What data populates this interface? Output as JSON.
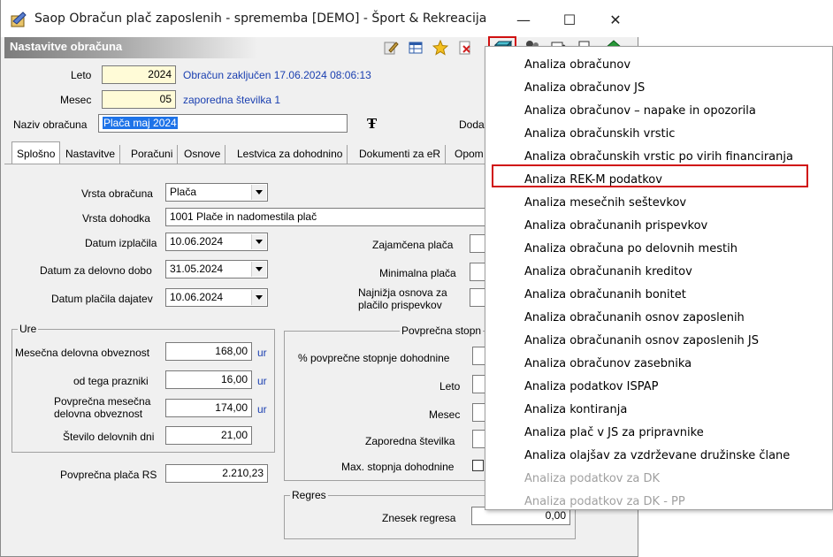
{
  "window": {
    "title": "Saop Obračun plač zaposlenih - sprememba [DEMO] - Šport & Rekreacija",
    "minimize": "—",
    "maximize": "☐",
    "close": "✕"
  },
  "panel": {
    "title": "Nastavitve obračuna"
  },
  "header": {
    "leto_label": "Leto",
    "leto_value": "2024",
    "obracun_status": "Obračun zaključen 17.06.2024 08:06:13",
    "mesec_label": "Mesec",
    "mesec_value": "05",
    "zaporedna": "zaporedna številka 1",
    "naziv_label": "Naziv obračuna",
    "naziv_value": "Plača maj 2024",
    "doda_label": "Doda"
  },
  "tabs": [
    "Splošno",
    "Nastavitve",
    "Poračuni",
    "Osnove",
    "Lestvica za dohodnino",
    "Dokumenti za eR",
    "Opom"
  ],
  "general": {
    "vrsta_obracuna_label": "Vrsta obračuna",
    "vrsta_obracuna_value": "Plača",
    "vrsta_dohodka_label": "Vrsta dohodka",
    "vrsta_dohodka_value": "1001  Plače in nadomestila plač",
    "datum_izplacila_label": "Datum izplačila",
    "datum_izplacila_value": "10.06.2024",
    "datum_delovno_label": "Datum za delovno dobo",
    "datum_delovno_value": "31.05.2024",
    "datum_dajatev_label": "Datum plačila dajatev",
    "datum_dajatev_value": "10.06.2024",
    "zajamcena_label": "Zajamčena plača",
    "minimalna_label": "Minimalna plača",
    "najnizja_label_1": "Najnižja osnova za",
    "najnizja_label_2": "plačilo prispevkov"
  },
  "ure": {
    "title": "Ure",
    "mesecna_label": "Mesečna delovna obveznost",
    "mesecna_value": "168,00",
    "prazniki_label": "od tega prazniki",
    "prazniki_value": "16,00",
    "povprecna_label_1": "Povprečna mesečna",
    "povprecna_label_2": "delovna obveznost",
    "povprecna_value": "174,00",
    "dni_label": "Število delovnih dni",
    "dni_value": "21,00",
    "unit": "ur"
  },
  "placa_rs": {
    "label": "Povprečna plača RS",
    "value": "2.210,23"
  },
  "stopnja": {
    "title": "Povprečna stopn",
    "pct_label": "% povprečne stopnje dohodnine",
    "leto_label": "Leto",
    "mesec_label": "Mesec",
    "zaporedna_label": "Zaporedna številka",
    "max_label": "Max. stopnja dohodnine"
  },
  "regres": {
    "title": "Regres",
    "znesek_label": "Znesek regresa",
    "znesek_value": "0,00"
  },
  "menu": {
    "items": [
      {
        "label": "Analiza obračunov",
        "enabled": true
      },
      {
        "label": "Analiza obračunov JS",
        "enabled": true
      },
      {
        "label": "Analiza obračunov – napake in opozorila",
        "enabled": true
      },
      {
        "label": "Analiza obračunskih vrstic",
        "enabled": true
      },
      {
        "label": "Analiza obračunskih vrstic po virih financiranja",
        "enabled": true
      },
      {
        "label": "Analiza REK-M podatkov",
        "enabled": true
      },
      {
        "label": "Analiza mesečnih seštevkov",
        "enabled": true
      },
      {
        "label": "Analiza obračunanih prispevkov",
        "enabled": true
      },
      {
        "label": "Analiza obračuna po delovnih mestih",
        "enabled": true
      },
      {
        "label": "Analiza obračunanih kreditov",
        "enabled": true
      },
      {
        "label": "Analiza obračunanih bonitet",
        "enabled": true
      },
      {
        "label": "Analiza obračunanih osnov zaposlenih",
        "enabled": true
      },
      {
        "label": "Analiza obračunanih osnov zaposlenih JS",
        "enabled": true
      },
      {
        "label": "Analiza obračunov zasebnika",
        "enabled": true
      },
      {
        "label": "Analiza podatkov ISPAP",
        "enabled": true
      },
      {
        "label": "Analiza kontiranja",
        "enabled": true
      },
      {
        "label": "Analiza plač v JS za pripravnike",
        "enabled": true
      },
      {
        "label": "Analiza olajšav za vzdrževane družinske člane",
        "enabled": true
      },
      {
        "label": "Analiza podatkov za DK",
        "enabled": false
      },
      {
        "label": "Analiza podatkov za DK - PP",
        "enabled": false
      }
    ]
  },
  "colors": {
    "highlight": "#d01010",
    "link_blue": "#1a3fb0",
    "input_yellow": "#fffbd7",
    "selection": "#1e73e8"
  }
}
